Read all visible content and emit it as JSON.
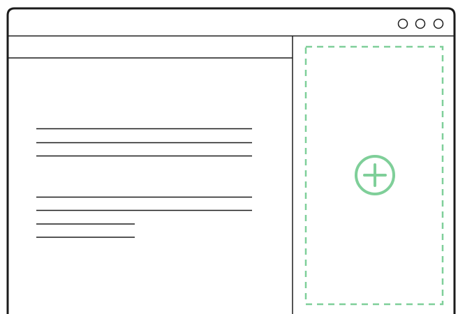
{
  "window": {
    "controls": [
      {
        "name": "window-control-1"
      },
      {
        "name": "window-control-2"
      },
      {
        "name": "window-control-3"
      }
    ]
  },
  "content": {
    "placeholder_text_lines": 7
  },
  "sidebar": {
    "drop_zone": {
      "icon": "add-circle-icon"
    }
  },
  "colors": {
    "frame": "#1b1b1b",
    "accent": "#7fcf99",
    "background": "#ffffff"
  }
}
